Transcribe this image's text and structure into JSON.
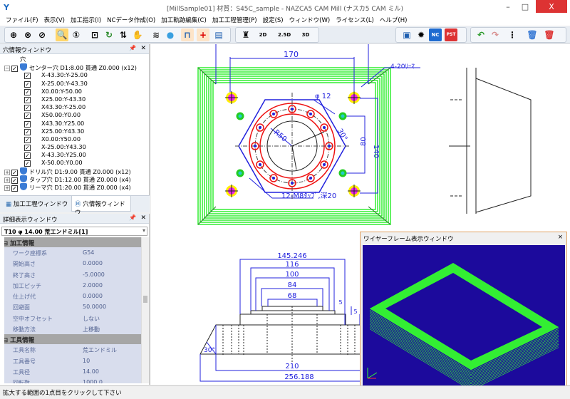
{
  "window": {
    "title": "[MillSample01] 材質：S45C_sample - NAZCA5 CAM Mill (ナスカ5 CAM ミル)",
    "minimize": "–",
    "maximize": "□",
    "close": "X"
  },
  "menu": [
    "ファイル(F)",
    "表示(V)",
    "加工指示(I)",
    "NCデータ作成(O)",
    "加工軌跡編集(C)",
    "加工工程管理(P)",
    "設定(S)",
    "ウィンドウ(W)",
    "ライセンス(L)",
    "ヘルプ(H)"
  ],
  "toolbar": {
    "icons": [
      "zoom-window",
      "zoom-all",
      "zoom-previous",
      "zoom-magnify",
      "zoom-one",
      "fit-view",
      "rotate-view",
      "flip",
      "pan-hand",
      "layers",
      "sphere",
      "hole-dim",
      "crosshair",
      "hole-view",
      "machine",
      "2d-tool",
      "2.5d-tool",
      "3d-tool",
      "frame",
      "gear",
      "nc",
      "pst",
      "undo",
      "redo",
      "tree",
      "trash-blue",
      "trash-red"
    ],
    "labels": {
      "nc": "NC",
      "pst": "PST",
      "2d": "2D",
      "25d": "2.5D",
      "3d": "3D"
    }
  },
  "hole_panel": {
    "title": "穴情報ウィンドウ",
    "root": "穴",
    "groups": [
      {
        "label": "センター穴 D1:8.00 貫通 Z0.000 (x12)",
        "expanded": true,
        "checked": true,
        "items": [
          "X-43.30:Y-25.00",
          "X-25.00:Y-43.30",
          "X0.00:Y-50.00",
          "X25.00:Y-43.30",
          "X43.30:Y-25.00",
          "X50.00:Y0.00",
          "X43.30:Y25.00",
          "X25.00:Y43.30",
          "X0.00:Y50.00",
          "X-25.00:Y43.30",
          "X-43.30:Y25.00",
          "X-50.00:Y0.00"
        ]
      },
      {
        "label": "ドリル穴 D1:9.00 貫通 Z0.000 (x12)",
        "expanded": false,
        "checked": true
      },
      {
        "label": "タップ穴 D1:12.00 貫通 Z0.000 (x4)",
        "expanded": false,
        "checked": true
      },
      {
        "label": "リーマ穴 D1:20.00 貫通 Z0.000 (x4)",
        "expanded": false,
        "checked": true
      }
    ],
    "tabs": [
      {
        "label": "加工工程ウィンドウ",
        "active": false
      },
      {
        "label": "穴情報ウィンドウ",
        "active": true
      }
    ]
  },
  "detail_panel": {
    "title": "詳細表示ウィンドウ",
    "selected_tool": "T10 φ 14.00 荒エンドミル[1]",
    "sections": [
      {
        "title": "加工情報",
        "rows": [
          [
            "ワーク座標系",
            "G54"
          ],
          [
            "開始高さ",
            "0.0000"
          ],
          [
            "終了高さ",
            "-5.0000"
          ],
          [
            "加工ピッチ",
            "2.0000"
          ],
          [
            "仕上げ代",
            "0.0000"
          ],
          [
            "回避面",
            "50.0000"
          ],
          [
            "空中オフセット",
            "しない"
          ],
          [
            "移動方法",
            "上移動"
          ]
        ]
      },
      {
        "title": "工具情報",
        "rows": [
          [
            "工具名称",
            "荒エンドミル"
          ],
          [
            "工具番号",
            "10"
          ],
          [
            "工具径",
            "14.00"
          ],
          [
            "回転数",
            "1000.0"
          ]
        ]
      }
    ]
  },
  "drawing": {
    "top_view": {
      "dim_170": "170",
      "reamer_note": "4-20ﾘｰﾏ",
      "phi": "φ 12",
      "angle": "30°",
      "radius": "R50",
      "dim_80": "80",
      "dim_140": "140",
      "tap_note": "12-M8ﾀｯﾌﾟ,深20"
    },
    "front_view": {
      "dims": [
        "145.246",
        "116",
        "100",
        "84",
        "68"
      ],
      "dim_5a": "5",
      "dim_5b": "5",
      "angle": "30°",
      "dim_210": "210",
      "dim_256": "256.188"
    },
    "colors": {
      "toolpath": "#33ee33",
      "part": "#2222dd",
      "holes": "#ee1111",
      "reamer": "#ffee00"
    }
  },
  "wireframe": {
    "title": "ワイヤーフレーム表示ウィンドウ",
    "close": "×",
    "background": "#1c0a9c",
    "path_color": "#33ff33"
  },
  "status": "拡大する範囲の1点目をクリックして下さい"
}
